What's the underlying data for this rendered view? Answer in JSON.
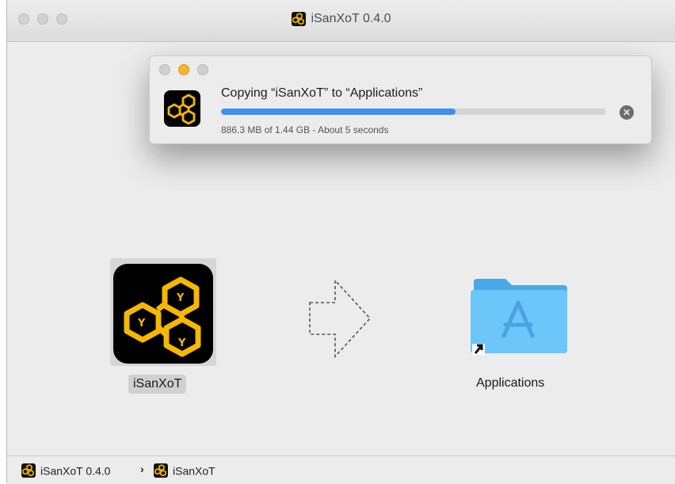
{
  "window": {
    "title": "iSanXoT 0.4.0",
    "title_icon": "isanxot-app-icon"
  },
  "copy_dialog": {
    "title": "Copying “iSanXoT” to “Applications”",
    "status": "886.3 MB of 1.44 GB - About 5 seconds",
    "progress_fraction": 0.61,
    "progress_color": "#3f8ff0",
    "icon": "isanxot-app-icon",
    "cancel_icon": "close-circle-icon"
  },
  "installer": {
    "app_label": "iSanXoT",
    "app_icon": "isanxot-app-icon",
    "arrow_icon": "dashed-arrow-right-icon",
    "folder_label": "Applications",
    "folder_icon": "applications-folder-icon",
    "alias_icon": "alias-arrow-icon"
  },
  "path_bar": {
    "items": [
      {
        "label": "iSanXoT 0.4.0",
        "icon": "isanxot-app-icon"
      },
      {
        "label": "iSanXoT",
        "icon": "isanxot-app-icon"
      }
    ],
    "separator_icon": "chevron-right-icon"
  },
  "colors": {
    "app_accent": "#f5b800",
    "folder_blue": "#5bbcf5"
  }
}
